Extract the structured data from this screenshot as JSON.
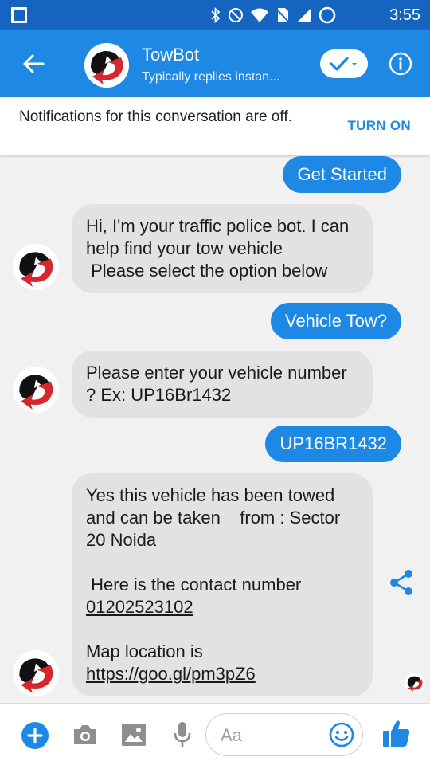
{
  "status_bar": {
    "time": "3:55"
  },
  "header": {
    "bot_name": "TowBot",
    "subtitle": "Typically replies instan...",
    "back_icon": "arrow-left-icon",
    "info_icon": "info-icon",
    "verify_icon": "check-dropdown-icon"
  },
  "notice": {
    "text": "Notifications for this conversation are off.",
    "action": "TURN ON"
  },
  "messages": [
    {
      "from": "user",
      "text": "Get Started"
    },
    {
      "from": "bot",
      "text": "Hi, I'm your traffic police bot. I can help find your tow vehicle\n Please select the option below"
    },
    {
      "from": "user",
      "text": "Vehicle Tow?"
    },
    {
      "from": "bot",
      "text": "Please enter your vehicle number ? Ex: UP16Br1432"
    },
    {
      "from": "user",
      "text": "UP16BR1432"
    },
    {
      "from": "bot",
      "text_part1": "Yes this vehicle has been towed and can be taken    from : Sector 20 Noida\n\n Here is the contact number",
      "phone": "01202523102",
      "map_prefix": "Map location is ",
      "map_link": "https://goo.gl/pm3pZ6"
    }
  ],
  "composer": {
    "placeholder": "Aa",
    "icons": [
      "plus-icon",
      "camera-icon",
      "image-icon",
      "microphone-icon",
      "emoji-icon",
      "thumbs-up-icon"
    ]
  },
  "colors": {
    "status_bar": "#1565c0",
    "header": "#1e88e5",
    "user_bubble": "#1e88e5",
    "bot_bubble": "#e2e2e2",
    "accent": "#1e88e5"
  }
}
